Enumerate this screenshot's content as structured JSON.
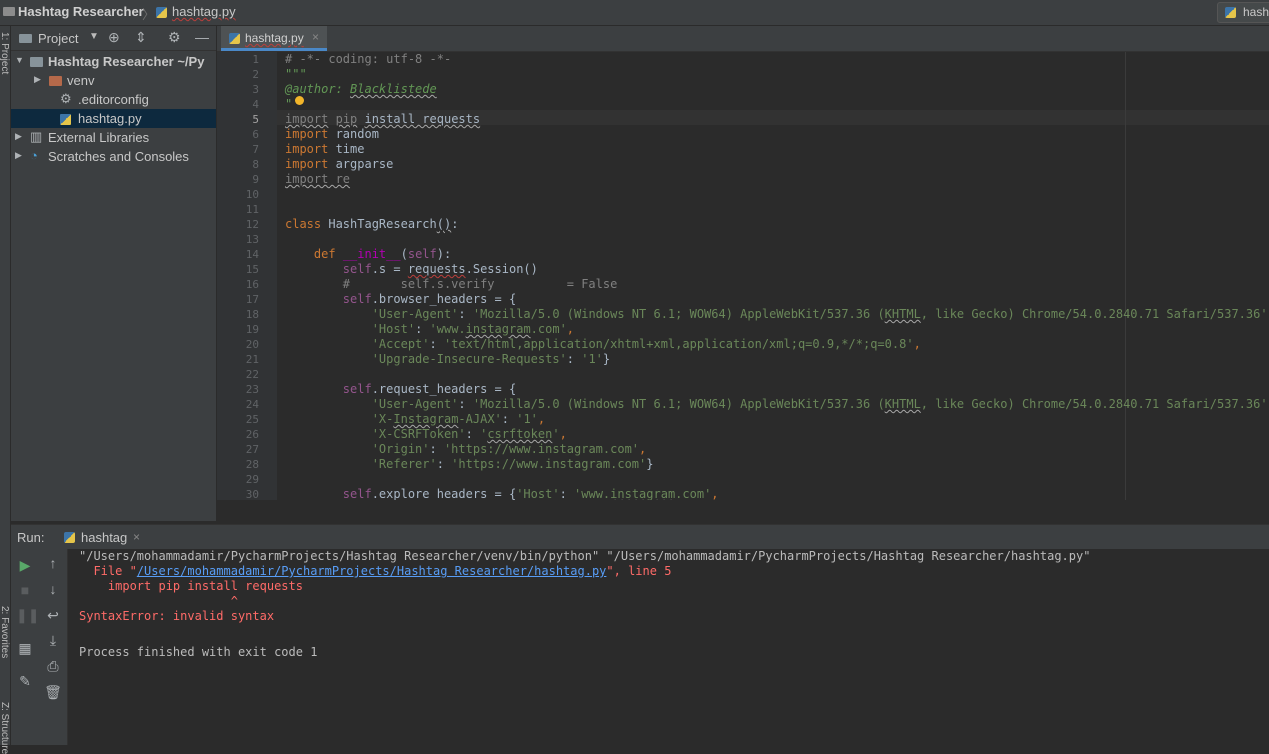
{
  "breadcrumb": {
    "project": "Hashtag Researcher",
    "separator": "〉",
    "file": "hashtag.py"
  },
  "run_config": {
    "label": "hashtag"
  },
  "left_stripe": {
    "project_tab": "1: Project",
    "favorites_tab": "2: Favorites",
    "structure_tab": "Z: Structure"
  },
  "project_panel": {
    "title": "Project",
    "tree": [
      {
        "label": "Hashtag Researcher  ~/Py",
        "bold": true,
        "expanded": true,
        "icon": "folder-icon"
      },
      {
        "label": "venv",
        "icon": "folder-icon"
      },
      {
        "label": ".editorconfig",
        "icon": "gear-icon"
      },
      {
        "label": "hashtag.py",
        "icon": "python-file-icon",
        "selected": true
      },
      {
        "label": "External Libraries",
        "icon": "library-icon"
      },
      {
        "label": "Scratches and Consoles",
        "icon": "scratches-icon"
      }
    ]
  },
  "editor": {
    "tab_label": "hashtag.py",
    "current_line": 5,
    "line_numbers": [
      "1",
      "2",
      "3",
      "4",
      "5",
      "6",
      "7",
      "8",
      "9",
      "10",
      "11",
      "12",
      "13",
      "14",
      "15",
      "16",
      "17",
      "18",
      "19",
      "20",
      "21",
      "22",
      "23",
      "24",
      "25",
      "26",
      "27",
      "28",
      "29",
      "30"
    ],
    "lines": [
      [
        [
          "cmt",
          "# -*- coding: utf-8 -*-"
        ]
      ],
      [
        [
          "doc",
          "\"\"\""
        ]
      ],
      [
        [
          "doc",
          "@author: "
        ],
        [
          "doc-u",
          "Blacklistede"
        ]
      ],
      [
        [
          "doc",
          "\""
        ]
      ],
      [
        [
          "dim-u",
          "import"
        ],
        [
          "plain",
          " "
        ],
        [
          "dim-u",
          "pip"
        ],
        [
          "plain",
          " "
        ],
        [
          "plain-u",
          "install requests"
        ]
      ],
      [
        [
          "kw",
          "import"
        ],
        [
          "plain",
          " random"
        ]
      ],
      [
        [
          "kw",
          "import"
        ],
        [
          "plain",
          " time"
        ]
      ],
      [
        [
          "kw",
          "import"
        ],
        [
          "plain",
          " argparse"
        ]
      ],
      [
        [
          "dim-u",
          "import re"
        ]
      ],
      [],
      [],
      [
        [
          "kw",
          "class "
        ],
        [
          "plain",
          "HashTagResearch"
        ],
        [
          "plain-u",
          "()"
        ],
        [
          "plain",
          ":"
        ]
      ],
      [],
      [
        [
          "plain",
          "    "
        ],
        [
          "kw",
          "def "
        ],
        [
          "magic",
          "__init__"
        ],
        [
          "plain",
          "("
        ],
        [
          "slf",
          "self"
        ],
        [
          "plain",
          "):"
        ]
      ],
      [
        [
          "plain",
          "        "
        ],
        [
          "slf",
          "self"
        ],
        [
          "plain",
          ".s = "
        ],
        [
          "plain-r",
          "requests"
        ],
        [
          "plain",
          ".Session()"
        ]
      ],
      [
        [
          "plain",
          "        "
        ],
        [
          "cmt",
          "#       self.s.verify          = False"
        ]
      ],
      [
        [
          "plain",
          "        "
        ],
        [
          "slf",
          "self"
        ],
        [
          "plain",
          ".browser_headers = {"
        ]
      ],
      [
        [
          "plain",
          "            "
        ],
        [
          "str",
          "'User-Agent'"
        ],
        [
          "plain",
          ": "
        ],
        [
          "str",
          "'Mozilla/5.0 (Windows NT 6.1; WOW64) AppleWebKit/537.36 ("
        ],
        [
          "str-u",
          "KHTML"
        ],
        [
          "str",
          ", like Gecko) Chrome/54.0.2840.71 Safari/537.36'"
        ],
        [
          "kw",
          ","
        ]
      ],
      [
        [
          "plain",
          "            "
        ],
        [
          "str",
          "'Host'"
        ],
        [
          "plain",
          ": "
        ],
        [
          "str",
          "'www."
        ],
        [
          "str-u",
          "instagram"
        ],
        [
          "str",
          ".com'"
        ],
        [
          "kw",
          ","
        ]
      ],
      [
        [
          "plain",
          "            "
        ],
        [
          "str",
          "'Accept'"
        ],
        [
          "plain",
          ": "
        ],
        [
          "str",
          "'text/html,application/xhtml+xml,application/xml;q=0.9,*/*;q=0.8'"
        ],
        [
          "kw",
          ","
        ]
      ],
      [
        [
          "plain",
          "            "
        ],
        [
          "str",
          "'Upgrade-Insecure-Requests'"
        ],
        [
          "plain",
          ": "
        ],
        [
          "str",
          "'1'"
        ],
        [
          "plain",
          "}"
        ]
      ],
      [],
      [
        [
          "plain",
          "        "
        ],
        [
          "slf",
          "self"
        ],
        [
          "plain",
          ".request_headers = {"
        ]
      ],
      [
        [
          "plain",
          "            "
        ],
        [
          "str",
          "'User-Agent'"
        ],
        [
          "plain",
          ": "
        ],
        [
          "str",
          "'Mozilla/5.0 (Windows NT 6.1; WOW64) AppleWebKit/537.36 ("
        ],
        [
          "str-u",
          "KHTML"
        ],
        [
          "str",
          ", like Gecko) Chrome/54.0.2840.71 Safari/537.36'"
        ],
        [
          "kw",
          ","
        ]
      ],
      [
        [
          "plain",
          "            "
        ],
        [
          "str",
          "'X-"
        ],
        [
          "str-u",
          "Instagram"
        ],
        [
          "str",
          "-AJAX'"
        ],
        [
          "plain",
          ": "
        ],
        [
          "str",
          "'1'"
        ],
        [
          "kw",
          ","
        ]
      ],
      [
        [
          "plain",
          "            "
        ],
        [
          "str",
          "'X-CSRFToken'"
        ],
        [
          "plain",
          ": "
        ],
        [
          "str",
          "'"
        ],
        [
          "str-u",
          "csrftoken"
        ],
        [
          "str",
          "'"
        ],
        [
          "kw",
          ","
        ]
      ],
      [
        [
          "plain",
          "            "
        ],
        [
          "str",
          "'Origin'"
        ],
        [
          "plain",
          ": "
        ],
        [
          "str",
          "'https://www.instagram.com'"
        ],
        [
          "kw",
          ","
        ]
      ],
      [
        [
          "plain",
          "            "
        ],
        [
          "str",
          "'Referer'"
        ],
        [
          "plain",
          ": "
        ],
        [
          "str",
          "'https://www.instagram.com'"
        ],
        [
          "plain",
          "}"
        ]
      ],
      [],
      [
        [
          "plain",
          "        "
        ],
        [
          "slf",
          "self"
        ],
        [
          "plain",
          ".explore_headers = {"
        ],
        [
          "str",
          "'Host'"
        ],
        [
          "plain",
          ": "
        ],
        [
          "str",
          "'www."
        ],
        [
          "str-u",
          "instagram"
        ],
        [
          "str",
          ".com'"
        ],
        [
          "kw",
          ","
        ]
      ]
    ]
  },
  "run_panel": {
    "label": "Run:",
    "tab_label": "hashtag",
    "console": [
      {
        "type": "norm",
        "text": "\"/Users/mohammadamir/PycharmProjects/Hashtag Researcher/venv/bin/python\" \"/Users/mohammadamir/PycharmProjects/Hashtag Researcher/hashtag.py\""
      },
      {
        "type": "file",
        "pre": "  File \"",
        "link": "/Users/mohammadamir/PycharmProjects/Hashtag Researcher/hashtag.py",
        "post": "\", line 5"
      },
      {
        "type": "err",
        "text": "    import pip install requests"
      },
      {
        "type": "err",
        "text": "                     ^"
      },
      {
        "type": "err",
        "text": "SyntaxError: invalid syntax"
      },
      {
        "type": "norm",
        "text": ""
      },
      {
        "type": "norm",
        "text": "Process finished with exit code 1"
      }
    ]
  },
  "colors": {
    "keyword": "#cc7832",
    "string": "#6a8759",
    "comment": "#808080",
    "self": "#94558d",
    "error": "#ff6b68",
    "link": "#589df6",
    "run_green": "#59a869"
  }
}
